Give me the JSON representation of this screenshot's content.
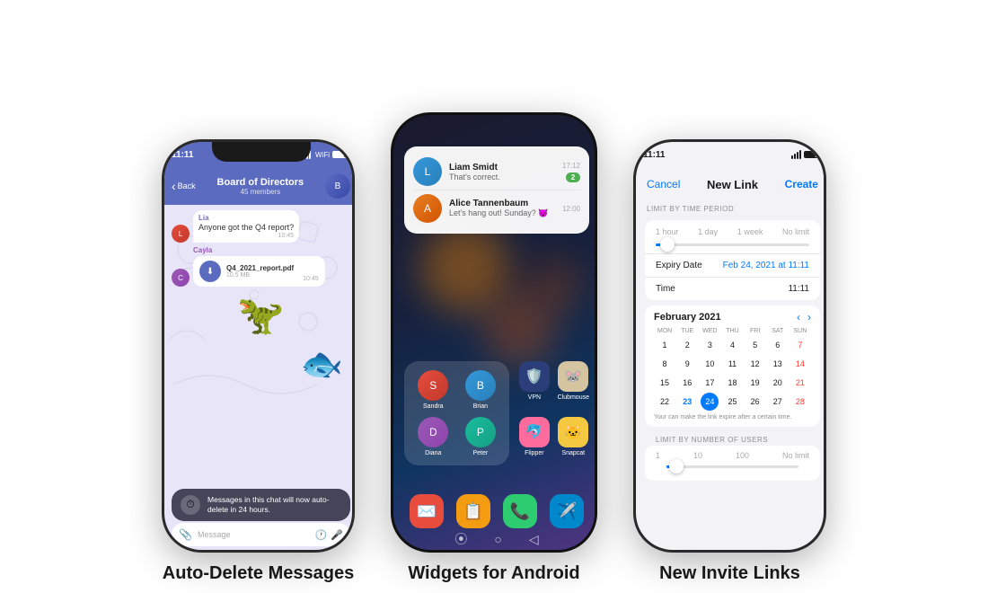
{
  "phones": {
    "phone1": {
      "caption": "Auto-Delete Messages",
      "status_time": "11:11",
      "header": {
        "back": "Back",
        "name": "Board of Directors",
        "members": "45 members"
      },
      "messages": [
        {
          "sender": "Lia",
          "text": "Anyone got the Q4 report?",
          "time": "10:45",
          "avatar_color": "red"
        },
        {
          "sender": "Cayla",
          "filename": "Q4_2021_report.pdf",
          "filesize": "10.5 MB",
          "time": "10:45",
          "avatar_color": "purple"
        }
      ],
      "banner": {
        "text": "Messages in this chat will now auto-delete in 24 hours."
      },
      "input_placeholder": "Message"
    },
    "phone2": {
      "caption": "Widgets for Android",
      "notifications": [
        {
          "name": "Liam Smidt",
          "message": "That's correct.",
          "time": "17:12",
          "badge": "2"
        },
        {
          "name": "Alice Tannenbaum",
          "message": "Let's hang out! Sunday? 😈",
          "time": "12:00"
        }
      ],
      "contacts": [
        {
          "name": "Sandra"
        },
        {
          "name": "Brian"
        },
        {
          "name": "Diana"
        },
        {
          "name": "Peter"
        }
      ],
      "apps": [
        {
          "name": "VPN",
          "color": "#1a1a3e"
        },
        {
          "name": "Clubmouse",
          "color": "#c8a882"
        },
        {
          "name": "Flipper",
          "color": "#ff6b9d"
        },
        {
          "name": "Snapcat",
          "color": "#f5c842"
        }
      ],
      "dock_apps": [
        "✉️",
        "📋",
        "📞",
        "✈️"
      ]
    },
    "phone3": {
      "caption": "New Invite Links",
      "status_time": "11:11",
      "nav": {
        "cancel": "Cancel",
        "title": "New Link",
        "create": "Create"
      },
      "limit_by_time": {
        "label": "LIMIT BY TIME PERIOD",
        "options": [
          "1 hour",
          "1 day",
          "1 week",
          "No limit"
        ]
      },
      "expiry": {
        "label": "Expiry Date",
        "value": "Feb 24, 2021 at 11:11"
      },
      "time_field": {
        "label": "Time",
        "value": "11:11"
      },
      "calendar": {
        "month": "February 2021",
        "days_header": [
          "MON",
          "TUE",
          "WED",
          "THU",
          "FRI",
          "SAT",
          "SUN"
        ],
        "weeks": [
          [
            "1",
            "2",
            "3",
            "4",
            "5",
            "6",
            "7"
          ],
          [
            "8",
            "9",
            "10",
            "11",
            "12",
            "13",
            "14"
          ],
          [
            "15",
            "16",
            "17",
            "18",
            "19",
            "20",
            "21"
          ],
          [
            "22",
            "23",
            "24",
            "25",
            "26",
            "27",
            "28"
          ]
        ],
        "today": "24",
        "selected": "23",
        "note": "Your can make the link expire after a certain time."
      },
      "limit_by_users": {
        "label": "LIMIT BY NUMBER OF USERS",
        "options": [
          "1",
          "10",
          "100",
          "No limit"
        ]
      }
    }
  }
}
